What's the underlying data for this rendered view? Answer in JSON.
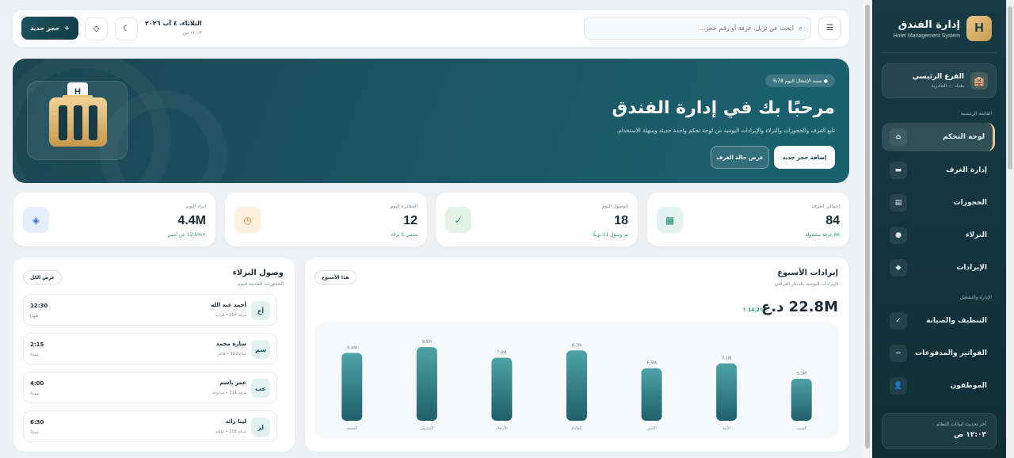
{
  "sidebar": {
    "brand_logo": "H",
    "brand_title": "إدارة الفندق",
    "brand_subtitle": "Hotel Management System",
    "branch": {
      "name": "الفرع الرئيسي",
      "location": "بغداد — الجادرية"
    },
    "section_main": "القائمة الرئيسية",
    "section_admin": "الإدارة والتشغيل",
    "items": [
      {
        "label": "لوحة التحكم",
        "icon": "home-icon",
        "active": true
      },
      {
        "label": "إدارة الغرف",
        "icon": "rooms-icon",
        "active": false
      },
      {
        "label": "الحجوزات",
        "icon": "bookings-icon",
        "active": false
      },
      {
        "label": "النزلاء",
        "icon": "guests-icon",
        "active": false
      },
      {
        "label": "الإيرادات",
        "icon": "revenue-icon",
        "active": false
      },
      {
        "label": "التنظيف والصيانة",
        "icon": "check-icon",
        "active": false
      },
      {
        "label": "الفواتير والمدفوعات",
        "icon": "invoice-icon",
        "active": false
      },
      {
        "label": "الموظفون",
        "icon": "staff-icon",
        "active": false
      }
    ],
    "update_label": "آخر تحديث لبيانات النظام",
    "update_time": "١٢:٠٣ ص"
  },
  "topbar": {
    "new_booking": "حجز جديد",
    "date": "الثلاثاء، ٤ آب ٢٠٢٦",
    "time": "١٢:٠٣ ص",
    "search_placeholder": "ابحث عن نزيل، غرفة أو رقم حجز..."
  },
  "hero": {
    "badge": "● نسبة الإشغال اليوم 78%",
    "title": "مرحبًا بك في إدارة الفندق",
    "description": "تابع الغرف والحجوزات والنزلاء والإيرادات اليومية من لوحة تحكم واحدة حديثة وسهلة الاستخدام.",
    "primary_button": "إضافة حجز جديد",
    "secondary_button": "عرض حالة الغرف"
  },
  "stats": [
    {
      "label": "إجمالي الغرف",
      "value": "84",
      "sub": "66 غرفة مشغولة",
      "icon": "grid-icon",
      "color": "#e3f3ef",
      "fg": "#1f8a70"
    },
    {
      "label": "الوصول اليوم",
      "value": "18",
      "sub": "تم وصول 11 نزيلًا",
      "icon": "check-icon",
      "color": "#e3f3ea",
      "fg": "#1f9a6e"
    },
    {
      "label": "المغادرة اليوم",
      "value": "12",
      "sub": "متبقي 5 نزلاء",
      "icon": "clock-icon",
      "color": "#fdf0df",
      "fg": "#d88a2a"
    },
    {
      "label": "إيراد اليوم",
      "value": "4.4M",
      "sub": "+12.5% عن أمس",
      "icon": "diamond-icon",
      "color": "#e5edfb",
      "fg": "#3a6fd8"
    }
  ],
  "revenue": {
    "title": "إيرادات الأسبوع",
    "subtitle": "الإيرادات اليومية بالدينار العراقي",
    "chip": "هذا الأسبوع",
    "total": "22.8M د.ع",
    "change": "↑ 14.2%"
  },
  "chart_data": {
    "type": "bar",
    "categories": [
      "السبت",
      "الأحد",
      "الاثنين",
      "الثلاثاء",
      "الأربعاء",
      "الخميس",
      "الجمعة"
    ],
    "values": [
      5.2,
      7.1,
      6.5,
      8.7,
      7.8,
      9.1,
      8.4
    ],
    "labels": [
      "5.2M",
      "7.1M",
      "6.5M",
      "8.7M",
      "7.8M",
      "9.1M",
      "8.4M"
    ],
    "ylim": [
      0,
      10
    ],
    "grid": false
  },
  "arrivals": {
    "title": "وصول النزلاء",
    "subtitle": "الحجوزات القادمة اليوم",
    "view_all": "عرض الكل",
    "items": [
      {
        "initials": "أع",
        "name": "أحمد عبد الله",
        "room": "غرفة 204 • فردية",
        "time": "12:30",
        "period": "ظهرًا"
      },
      {
        "initials": "سم",
        "name": "سارة محمد",
        "room": "جناح 302 • فاخر",
        "time": "2:15",
        "period": "مساءً"
      },
      {
        "initials": "عب",
        "name": "عمر باسم",
        "room": "غرفة 311 • مزدوجة",
        "time": "4:00",
        "period": "مساءً"
      },
      {
        "initials": "لر",
        "name": "لينا رائد",
        "room": "غرفة 108 • عائلية",
        "time": "6:30",
        "period": "مساءً"
      }
    ]
  }
}
